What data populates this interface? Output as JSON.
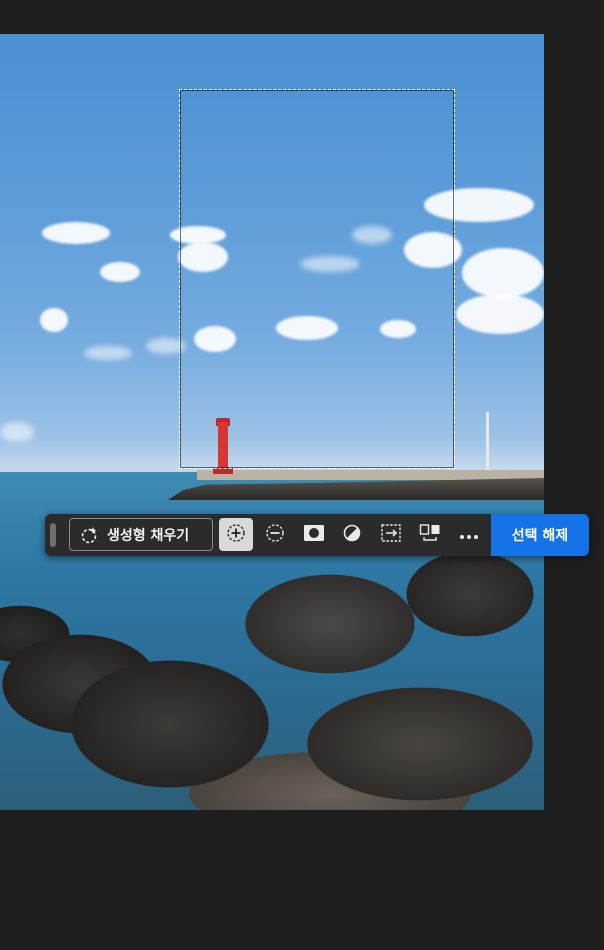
{
  "canvas": {
    "image_description_name": "seaside-photo"
  },
  "taskbar": {
    "generative_fill_label": "생성형 채우기",
    "deselect_label": "선택 해제",
    "tools": [
      {
        "name": "add-to-selection",
        "icon": "plus-circle-icon",
        "active": true
      },
      {
        "name": "subtract-from-selection",
        "icon": "minus-circle-icon",
        "active": false
      },
      {
        "name": "mask-selection",
        "icon": "mask-icon",
        "active": false
      },
      {
        "name": "invert-selection",
        "icon": "invert-icon",
        "active": false
      },
      {
        "name": "transform-selection",
        "icon": "transform-icon",
        "active": false
      },
      {
        "name": "fill-selection",
        "icon": "fill-icon",
        "active": false
      },
      {
        "name": "more-options",
        "icon": "ellipsis-icon",
        "active": false
      }
    ]
  },
  "colors": {
    "app_background": "#1e1e1e",
    "taskbar_background": "#2b2b2b",
    "accent": "#1473e6",
    "active_tool": "#d9d9d9"
  }
}
